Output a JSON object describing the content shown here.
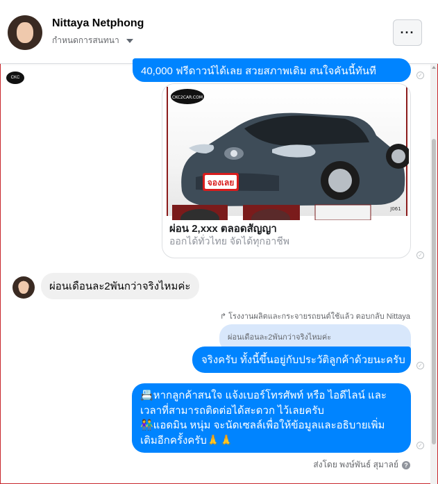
{
  "header": {
    "name": "Nittaya Netphong",
    "subtitle": "กำหนดการสนทนา",
    "more_label": "···"
  },
  "messages": {
    "top_out": "40,000 ฟรีดาวน์ได้เลย สวยสภาพเดิม สนใจคันนี้ทันที",
    "card": {
      "image_logo": "CKC2CAR.COM",
      "plate_text": "จองเลย",
      "code": "J061",
      "title": "ผ่อน 2,xxx ตลอดสัญญา",
      "subtitle": "ออกได้ทั่วไทย จัดได้ทุกอาชีพ"
    },
    "incoming": "ผ่อนเดือนละ2พันกว่าจริงไหมค่ะ",
    "reply_note": "โรงงานผลิตและกระจายรถยนต์ใช้แล้ว ตอบกลับ Nittaya",
    "quoted": "ผ่อนเดือนละ2พันกว่าจริงไหมค่ะ",
    "reply": "จริงครับ ทั้งนี้ขึ้นอยู่กับประวัติลูกค้าด้วยนะครับ",
    "final_lines": [
      "📇หากลูกค้าสนใจ แจ้งเบอร์โทรศัพท์ หรือ ไอดีไลน์ และ",
      "เวลาที่สามารถติดต่อได้สะดวก ไว้เลยครับ",
      "👫แอดมิน หนุ่ม จะนัดเซลล์เพื่อให้ข้อมูลและอธิบายเพิ่ม",
      "เติมอีกครั้งครับ🙏🙏"
    ],
    "sent_by": "ส่งโดย พงษ์พันธ์ สุมาลย์"
  },
  "colors": {
    "outgoing_bubble": "#0084ff",
    "incoming_bubble": "#f0f0f0",
    "frame_border": "#c8262c"
  },
  "icons": {
    "more": "ellipsis-icon",
    "caret": "caret-down-icon",
    "seen": "seen-check-icon",
    "reply": "reply-arrow-icon",
    "help": "question-icon"
  }
}
